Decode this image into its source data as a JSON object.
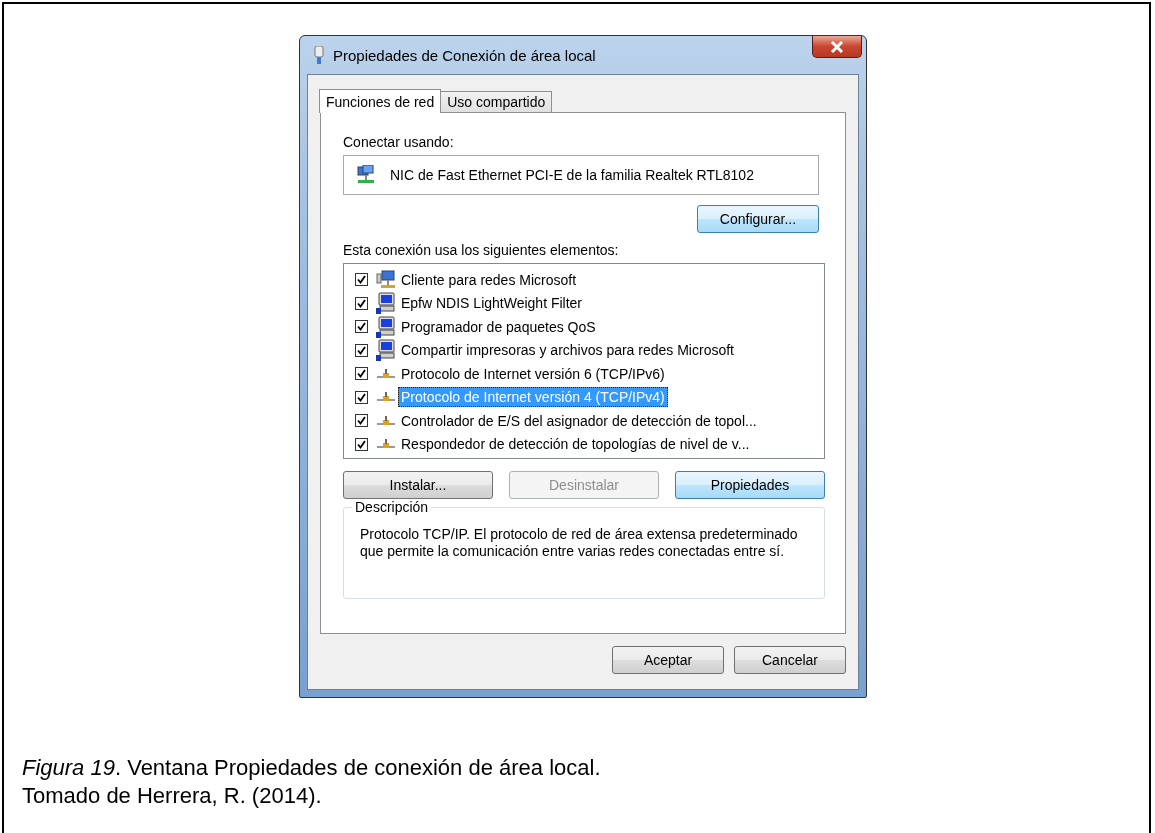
{
  "window": {
    "title": "Propiedades de Conexión de área local"
  },
  "tabs": [
    {
      "label": "Funciones de red",
      "selected": true
    },
    {
      "label": "Uso compartido",
      "selected": false
    }
  ],
  "connect_using": {
    "label": "Conectar usando:",
    "adapter": "NIC de Fast Ethernet PCI-E de la familia Realtek RTL8102"
  },
  "configure_button": {
    "label": "Configurar...",
    "disabled": false
  },
  "items_label": "Esta conexión usa los siguientes elementos:",
  "items": [
    {
      "kind": "client",
      "label": "Cliente para redes Microsoft",
      "checked": true,
      "selected": false
    },
    {
      "kind": "service",
      "label": "Epfw NDIS LightWeight Filter",
      "checked": true,
      "selected": false
    },
    {
      "kind": "service",
      "label": "Programador de paquetes QoS",
      "checked": true,
      "selected": false
    },
    {
      "kind": "service",
      "label": "Compartir impresoras y archivos para redes Microsoft",
      "checked": true,
      "selected": false
    },
    {
      "kind": "protocol",
      "label": "Protocolo de Internet versión 6 (TCP/IPv6)",
      "checked": true,
      "selected": false
    },
    {
      "kind": "protocol",
      "label": "Protocolo de Internet versión 4 (TCP/IPv4)",
      "checked": true,
      "selected": true
    },
    {
      "kind": "protocol",
      "label": "Controlador de E/S del asignador de detección de topol...",
      "checked": true,
      "selected": false
    },
    {
      "kind": "protocol",
      "label": "Respondedor de detección de topologías de nivel de v...",
      "checked": true,
      "selected": false
    }
  ],
  "item_buttons": [
    {
      "label": "Instalar...",
      "disabled": false,
      "default": false
    },
    {
      "label": "Desinstalar",
      "disabled": true,
      "default": false
    },
    {
      "label": "Propiedades",
      "disabled": false,
      "default": true
    }
  ],
  "description": {
    "legend": "Descripción",
    "text": "Protocolo TCP/IP. El protocolo de red de área extensa predeterminado que permite la comunicación entre varias redes conectadas entre sí."
  },
  "dialog_buttons": [
    {
      "label": "Aceptar"
    },
    {
      "label": "Cancelar"
    }
  ],
  "caption": [
    "*Figura 19*. Ventana Propiedades de conexión de área local.",
    "Tomado de Herrera, R. (2014)."
  ]
}
